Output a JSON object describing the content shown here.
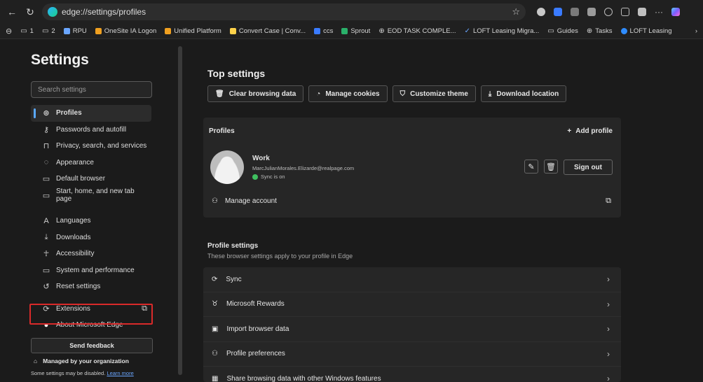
{
  "browser": {
    "url": "edge://settings/profiles",
    "favorites": [
      {
        "label": "1",
        "icon": "folder-icon"
      },
      {
        "label": "2",
        "icon": "folder-icon"
      },
      {
        "label": "RPU",
        "icon": "site-icon"
      },
      {
        "label": "OneSite IA Logon",
        "icon": "site-icon"
      },
      {
        "label": "Unified Platform",
        "icon": "site-icon"
      },
      {
        "label": "Convert Case | Conv...",
        "icon": "site-icon"
      },
      {
        "label": "ccs",
        "icon": "site-icon"
      },
      {
        "label": "Sprout",
        "icon": "site-icon"
      },
      {
        "label": "EOD TASK COMPLE...",
        "icon": "globe-icon"
      },
      {
        "label": "LOFT Leasing Migra...",
        "icon": "site-icon"
      },
      {
        "label": "Guides",
        "icon": "folder-icon"
      },
      {
        "label": "Tasks",
        "icon": "globe-icon"
      },
      {
        "label": "LOFT Leasing",
        "icon": "site-icon"
      }
    ]
  },
  "sidebar": {
    "title": "Settings",
    "search_placeholder": "Search settings",
    "items": [
      {
        "label": "Profiles",
        "icon": "profile-icon",
        "active": true
      },
      {
        "label": "Passwords and autofill",
        "icon": "key-icon"
      },
      {
        "label": "Privacy, search, and services",
        "icon": "lock-icon"
      },
      {
        "label": "Appearance",
        "icon": "appearance-icon"
      },
      {
        "label": "Default browser",
        "icon": "browser-icon"
      },
      {
        "label": "Start, home, and new tab page",
        "icon": "home-icon"
      },
      {
        "label": "Languages",
        "icon": "languages-icon"
      },
      {
        "label": "Downloads",
        "icon": "download-icon"
      },
      {
        "label": "Accessibility",
        "icon": "accessibility-icon"
      },
      {
        "label": "System and performance",
        "icon": "laptop-icon"
      },
      {
        "label": "Reset settings",
        "icon": "reset-icon"
      }
    ],
    "extensions_label": "Extensions",
    "about_label": "About Microsoft Edge",
    "feedback_label": "Send feedback",
    "managed_label": "Managed by your organization",
    "disabled_note": "Some settings may be disabled.",
    "learn_more": "Learn more"
  },
  "main": {
    "top_settings_title": "Top settings",
    "quick_actions": [
      {
        "label": "Clear browsing data",
        "icon": "trash-icon"
      },
      {
        "label": "Manage cookies",
        "icon": "cookie-icon"
      },
      {
        "label": "Customize theme",
        "icon": "theme-icon"
      },
      {
        "label": "Download location",
        "icon": "download-icon"
      }
    ],
    "profiles": {
      "heading": "Profiles",
      "add_profile": "Add profile",
      "name": "Work",
      "email": "MarcJulianMorales.Elizarde@realpage.com",
      "sync_status": "Sync is on",
      "sign_out": "Sign out",
      "manage_account": "Manage account"
    },
    "profile_settings": {
      "title": "Profile settings",
      "subtitle": "These browser settings apply to your profile in Edge",
      "rows": [
        {
          "label": "Sync",
          "icon": "sync-icon"
        },
        {
          "label": "Microsoft Rewards",
          "icon": "rewards-icon"
        },
        {
          "label": "Import browser data",
          "icon": "import-icon"
        },
        {
          "label": "Profile preferences",
          "icon": "preferences-icon"
        },
        {
          "label": "Share browsing data with other Windows features",
          "icon": "windows-icon"
        }
      ]
    }
  }
}
